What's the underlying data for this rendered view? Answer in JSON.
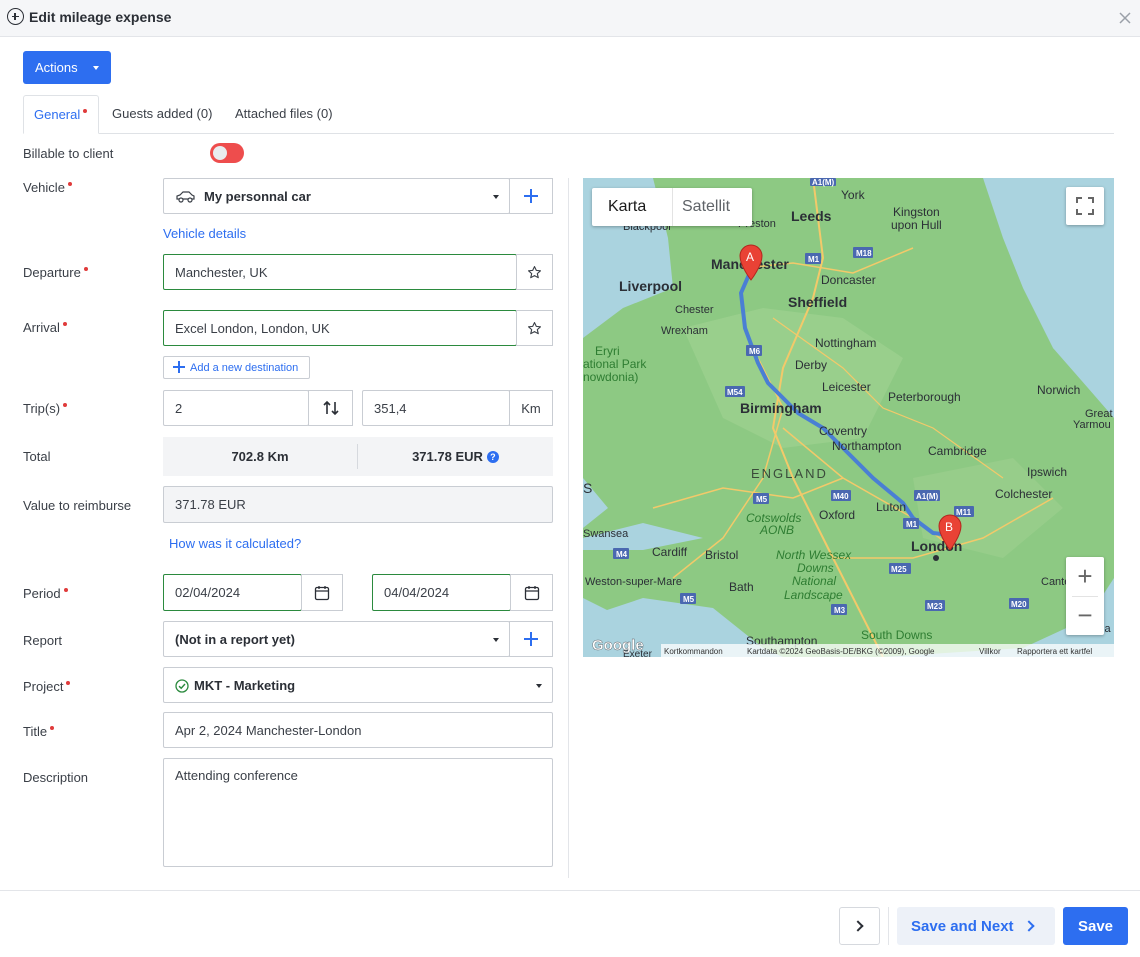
{
  "header": {
    "title": "Edit mileage expense"
  },
  "toolbar": {
    "actions_label": "Actions"
  },
  "tabs": [
    {
      "label": "General",
      "required": true,
      "active": true
    },
    {
      "label": "Guests added (0)"
    },
    {
      "label": "Attached files (0)"
    }
  ],
  "form": {
    "billable": {
      "label": "Billable to client",
      "value": false
    },
    "vehicle": {
      "label": "Vehicle",
      "value": "My personnal car",
      "details_link": "Vehicle details"
    },
    "departure": {
      "label": "Departure",
      "value": "Manchester, UK"
    },
    "arrival": {
      "label": "Arrival",
      "value": "Excel London, London, UK",
      "add_destination": "Add a new destination"
    },
    "trips": {
      "label": "Trip(s)",
      "count": "2",
      "distance": "351,4",
      "unit": "Km"
    },
    "total": {
      "label": "Total",
      "distance": "702.8 Km",
      "amount": "371.78 EUR"
    },
    "reimburse": {
      "label": "Value to reimburse",
      "value": "371.78 EUR",
      "calc_link": "How was it calculated?"
    },
    "period": {
      "label": "Period",
      "start": "02/04/2024",
      "end": "04/04/2024"
    },
    "report": {
      "label": "Report",
      "value": "(Not in a report yet)"
    },
    "project": {
      "label": "Project",
      "value": "MKT - Marketing"
    },
    "title": {
      "label": "Title",
      "value": "Apr 2, 2024 Manchester-London"
    },
    "description": {
      "label": "Description",
      "value": "Attending conference"
    }
  },
  "map": {
    "type_options": [
      "Karta",
      "Satellit"
    ],
    "active_type": "Karta",
    "markers": [
      "A",
      "B"
    ],
    "cities": {
      "york": "York",
      "leeds": "Leeds",
      "kingston": "Kingston",
      "upon_hull": "upon Hull",
      "blackpool": "Blackpool",
      "preston": "Preston",
      "manchester": "Manchester",
      "liverpool": "Liverpool",
      "doncaster": "Doncaster",
      "sheffield": "Sheffield",
      "chester": "Chester",
      "wrexham": "Wrexham",
      "eryri": "Eryri",
      "national_park": "ational Park",
      "snowdonia": "nowdonia)",
      "nottingham": "Nottingham",
      "derby": "Derby",
      "leicester": "Leicester",
      "norwich": "Norwich",
      "great": "Great",
      "yarmouth": "Yarmou",
      "peterborough": "Peterborough",
      "birmingham": "Birmingham",
      "coventry": "Coventry",
      "northampton": "Northampton",
      "cambridge": "Cambridge",
      "england": "ENGLAND",
      "ipswich": "Ipswich",
      "colchester": "Colchester",
      "luton": "Luton",
      "cotswolds": "Cotswolds",
      "aonb": "AONB",
      "oxford": "Oxford",
      "swansea": "Swansea",
      "cardiff": "Cardiff",
      "bristol": "Bristol",
      "north_wessex": "North Wessex",
      "downs": "Downs",
      "national": "National",
      "landscape": "Landscape",
      "london": "London",
      "canterbury": "Canterbur",
      "weston": "Weston-super-Mare",
      "bath": "Bath",
      "southampton": "Southampton",
      "south_downs": "South Downs",
      "exeter": "Exeter",
      "s_edge": "S",
      "la_edge": "la"
    },
    "roads": [
      "A1(M)",
      "M18",
      "M1",
      "M6",
      "M54",
      "M5",
      "M40",
      "M4",
      "M25",
      "M23",
      "M20",
      "M11",
      "M3",
      "A1(M)",
      "M1"
    ],
    "attribution": {
      "google": "Google",
      "shortcuts": "Kortkommandon",
      "data": "Kartdata ©2024 GeoBasis-DE/BKG (©2009), Google",
      "terms": "Villkor",
      "report": "Rapportera ett kartfel"
    },
    "zoom_in": "+",
    "zoom_out": "−"
  },
  "footer": {
    "save_next_label": "Save and Next",
    "save_label": "Save"
  },
  "colors": {
    "primary": "#2d6ef0",
    "required": "#e03b3b",
    "valid": "#2b8a3e",
    "toggle_off": "#ee4d4d",
    "route": "#4a7fd4",
    "map_land": "#7fbf7a",
    "map_sea": "#aad3df"
  }
}
